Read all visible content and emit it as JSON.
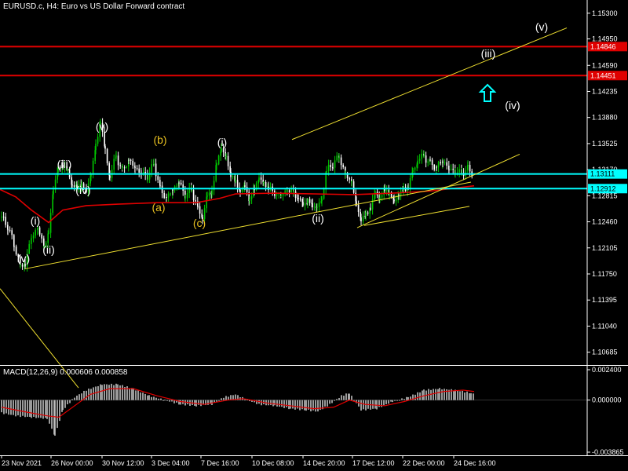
{
  "chart_header": {
    "title": "EURUSD.c, H4:  Euro vs US Dollar Forward contract",
    "macd_title": "MACD(12,26,9) 0.000606 0.000858"
  },
  "colors": {
    "background": "#000000",
    "grid": "#1e1e1e",
    "axis": "#ffffff",
    "bull_candle": "#00c800",
    "bear_candle": "#ffffff",
    "moving_average": "#e00000",
    "resistance_line": "#e00000",
    "support_line": "#00ffff",
    "trendline": "#f0e030",
    "wave_white": "#ffffff",
    "wave_yellow": "#e8c020",
    "macd_histogram": "#c0c0c0",
    "macd_signal": "#e00000",
    "arrow": "#00ffff"
  },
  "chart_data": [
    {
      "type": "candlestick",
      "symbol": "EURUSD.c",
      "timeframe": "H4",
      "ylim": [
        1.1051,
        1.1548
      ],
      "y_ticks": [
        "1.15300",
        "1.14950",
        "1.14590",
        "1.14235",
        "1.13880",
        "1.13525",
        "1.13170",
        "1.12815",
        "1.12460",
        "1.12105",
        "1.11750",
        "1.11395",
        "1.11040",
        "1.10685"
      ],
      "x_ticks": [
        "23 Nov 2021",
        "26 Nov 00:00",
        "30 Nov 12:00",
        "3 Dec 04:00",
        "7 Dec 16:00",
        "10 Dec 08:00",
        "14 Dec 20:00",
        "17 Dec 12:00",
        "22 Dec 00:00",
        "24 Dec 16:00"
      ],
      "horizontal_levels": [
        {
          "label": "1.14846",
          "value": 1.14846,
          "color": "#e00000"
        },
        {
          "label": "1.14451",
          "value": 1.14451,
          "color": "#e00000"
        },
        {
          "label": "1.13111",
          "value": 1.13111,
          "color": "#00ffff"
        },
        {
          "label": "1.12912",
          "value": 1.12912,
          "color": "#00ffff"
        }
      ],
      "wave_labels": [
        {
          "text": "(v)",
          "color": "white"
        },
        {
          "text": "(i)",
          "color": "white"
        },
        {
          "text": "(ii)",
          "color": "white"
        },
        {
          "text": "(iii)",
          "color": "white"
        },
        {
          "text": "(iv)",
          "color": "white"
        },
        {
          "text": "(v)",
          "color": "white"
        },
        {
          "text": "(a)",
          "color": "yellow"
        },
        {
          "text": "(b)",
          "color": "yellow"
        },
        {
          "text": "(c)",
          "color": "yellow"
        },
        {
          "text": "(i)",
          "color": "white"
        },
        {
          "text": "(ii)",
          "color": "white"
        },
        {
          "text": "(iii)",
          "color": "white"
        },
        {
          "text": "(iv)",
          "color": "white"
        },
        {
          "text": "(v)",
          "color": "white"
        }
      ],
      "indicators": [
        "moving average",
        "trend lines",
        "up arrow"
      ]
    },
    {
      "type": "macd",
      "params": "12,26,9",
      "main": 0.000606,
      "signal": 0.000858,
      "y_ticks": [
        "0.002400",
        "0.000000",
        "-0.003865"
      ],
      "ylim": [
        -0.003865,
        0.0024
      ]
    }
  ]
}
